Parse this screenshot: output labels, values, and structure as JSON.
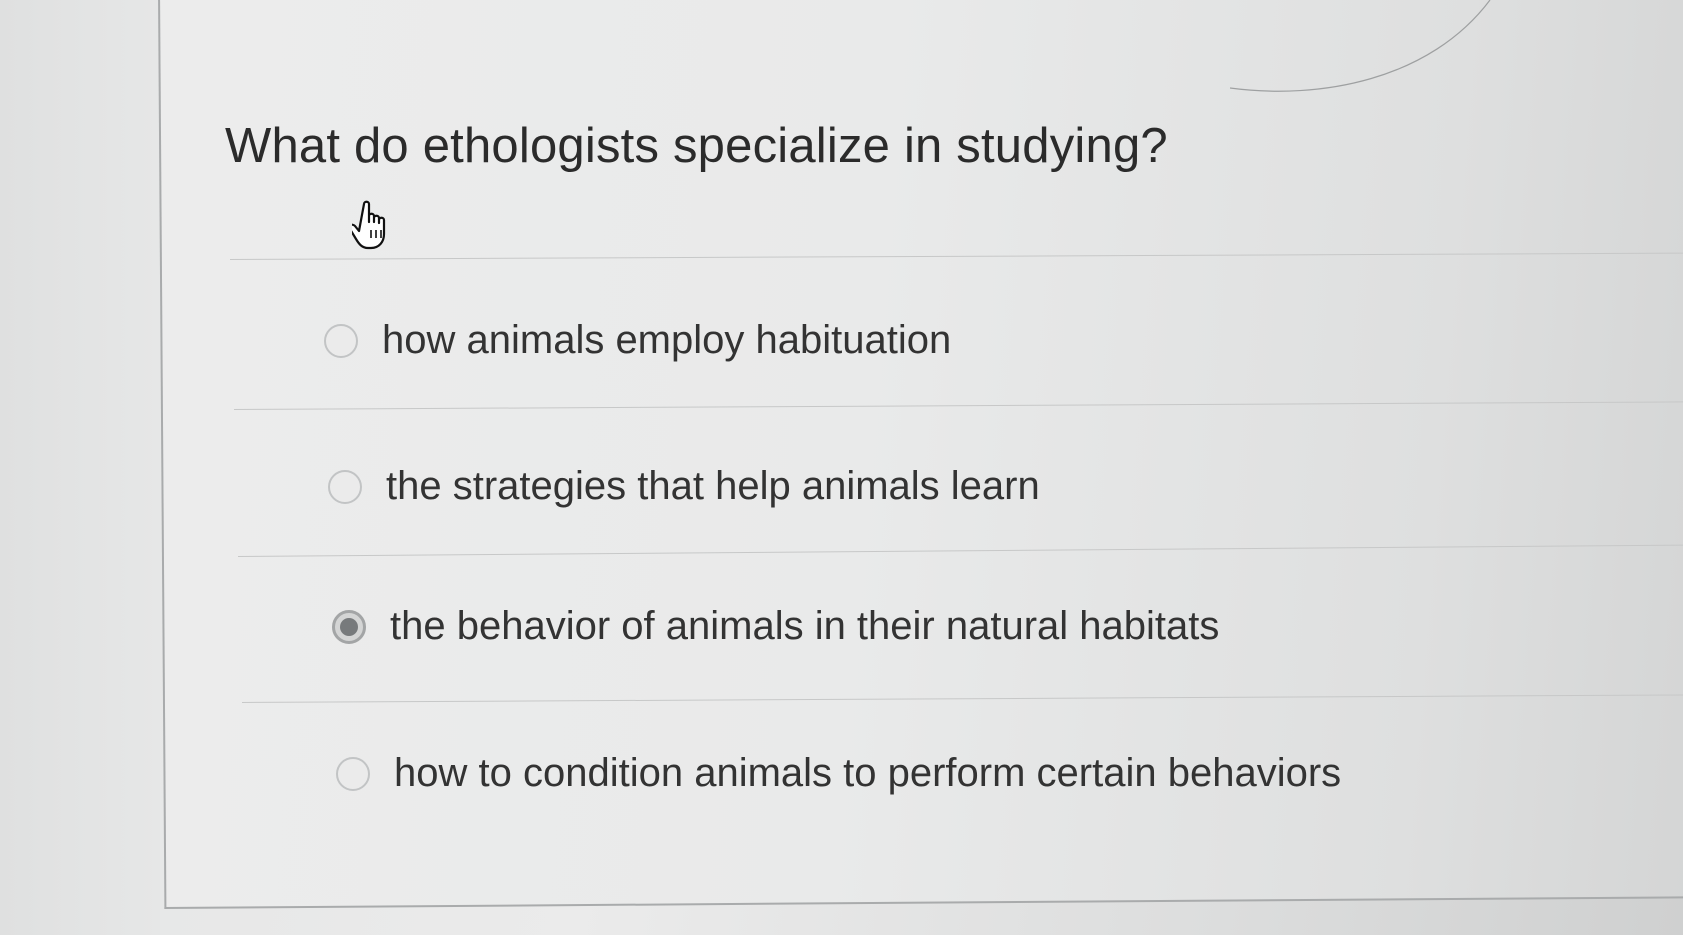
{
  "question": {
    "text": "What do ethologists specialize in studying?"
  },
  "options": [
    {
      "label": "how animals employ habituation",
      "selected": false
    },
    {
      "label": "the strategies that help animals learn",
      "selected": false
    },
    {
      "label": "the behavior of animals in their natural habitats",
      "selected": true
    },
    {
      "label": "how to condition animals to perform certain behaviors",
      "selected": false
    }
  ],
  "cursor": {
    "icon": "hand-pointer-icon"
  }
}
